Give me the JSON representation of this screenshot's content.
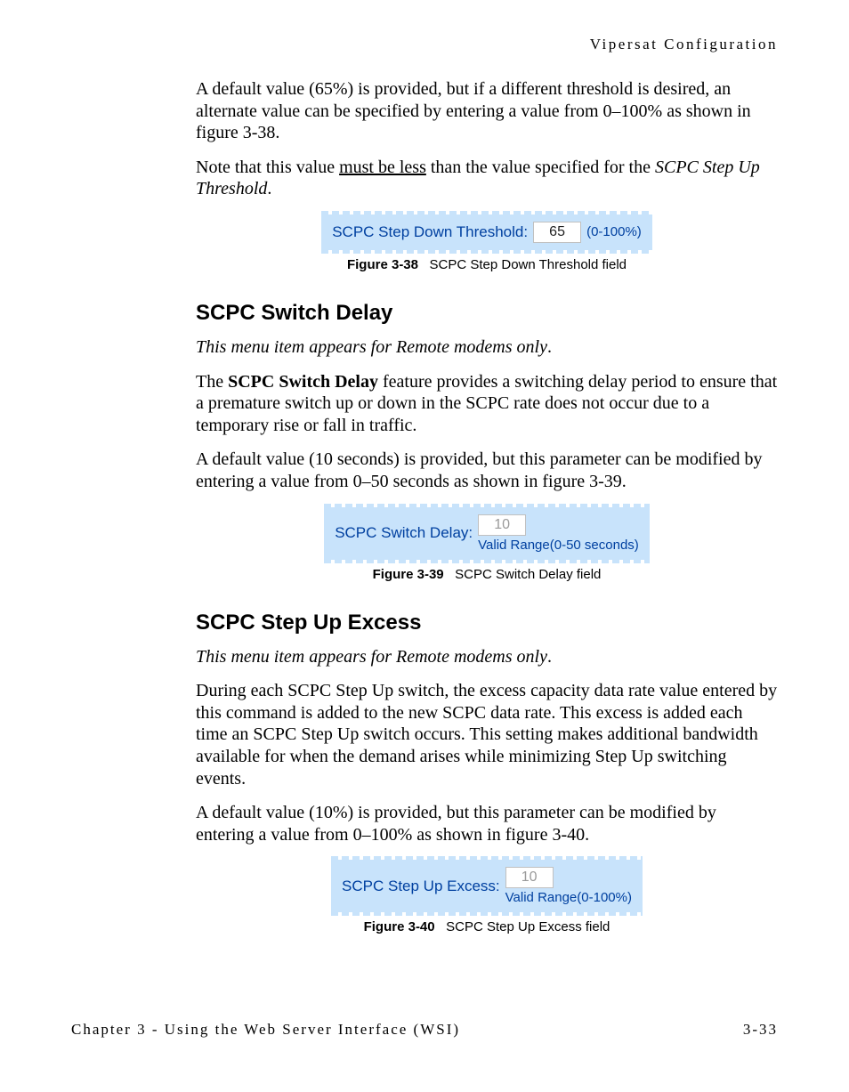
{
  "running_head": "Vipersat Configuration",
  "intro": {
    "p1": "A default value (65%) is provided, but if a different threshold is desired, an alternate value can be specified by entering a value from 0–100% as shown in figure 3-38.",
    "p2a": "Note that this value ",
    "p2u": "must be less",
    "p2b": " than the value specified for the ",
    "p2i": "SCPC Step Up Threshold",
    "p2c": "."
  },
  "fig38": {
    "label": "SCPC Step Down Threshold:",
    "value": "65",
    "range": "(0-100%)",
    "caption_no": "Figure 3-38",
    "caption_txt": "SCPC Step Down Threshold field"
  },
  "switch_delay": {
    "heading": "SCPC Switch Delay",
    "note": "This menu item appears for Remote modems only",
    "p1a": "The ",
    "p1b": "SCPC Switch Delay",
    "p1c": " feature provides a switching delay period to ensure that a premature switch up or down in the SCPC rate does not occur due to a temporary rise or fall in traffic.",
    "p2": "A default value (10 seconds) is provided, but this parameter can be modified by entering a value from 0–50 seconds as shown in figure 3-39."
  },
  "fig39": {
    "label": "SCPC Switch Delay:",
    "value": "10",
    "range": "Valid Range(0-50 seconds)",
    "caption_no": "Figure 3-39",
    "caption_txt": "SCPC Switch Delay field"
  },
  "step_up": {
    "heading": "SCPC Step Up Excess",
    "note": "This menu item appears for Remote modems only",
    "p1": "During each SCPC Step Up switch, the excess capacity data rate value entered by this command is added to the new SCPC data rate. This excess is added each time an SCPC Step Up switch occurs. This setting makes additional bandwidth available for when the demand arises while minimizing Step Up switching events.",
    "p2": "A default value (10%) is provided, but this parameter can be modified by entering a value from 0–100% as shown in figure 3-40."
  },
  "fig40": {
    "label": "SCPC Step Up Excess:",
    "value": "10",
    "range": "Valid Range(0-100%)",
    "caption_no": "Figure 3-40",
    "caption_txt": "SCPC Step Up Excess field"
  },
  "footer": {
    "left": "Chapter 3 - Using the Web Server Interface (WSI)",
    "right": "3-33"
  }
}
